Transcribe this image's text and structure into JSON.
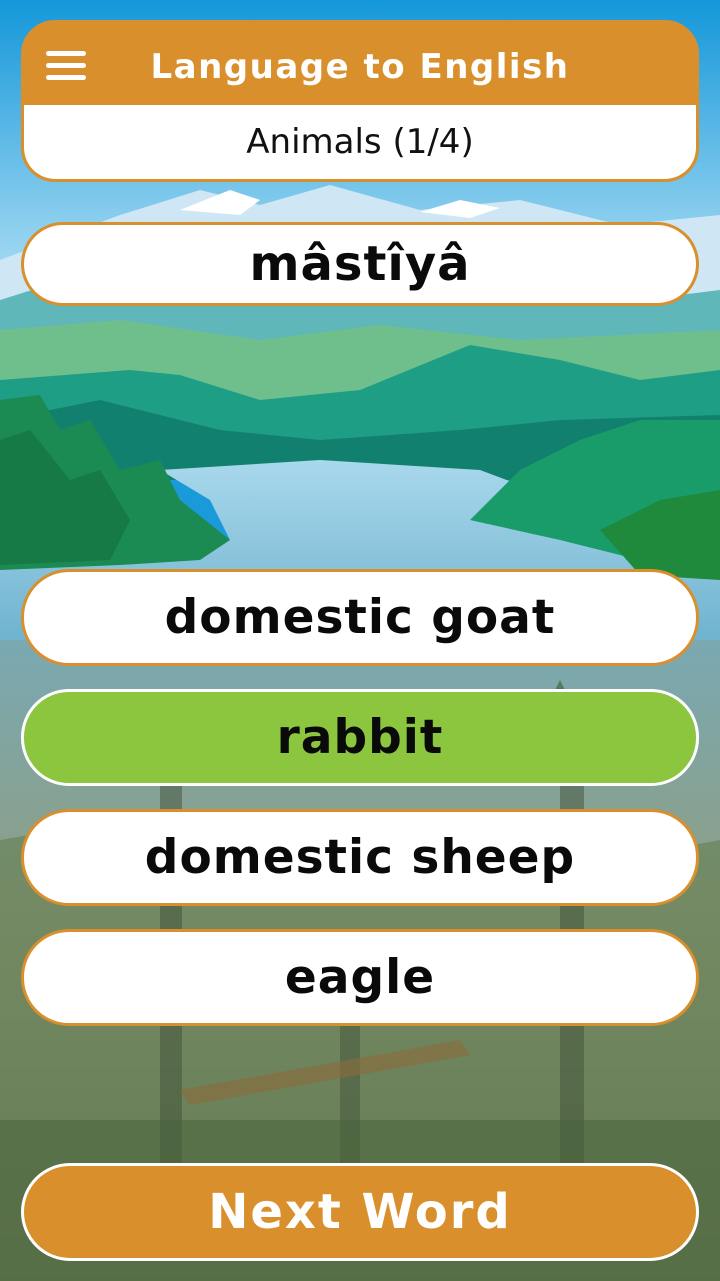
{
  "header": {
    "title": "Language to English",
    "subtitle": "Animals (1/4)"
  },
  "word": "mâstîyâ",
  "choices": [
    "domestic goat",
    "rabbit",
    "domestic sheep",
    "eagle"
  ],
  "selected_choice": "rabbit",
  "next_button": "Next Word",
  "colors": {
    "accent": "#d98f2c",
    "selected": "#8cc63f",
    "card": "#ffffff"
  },
  "icons": {
    "menu": "hamburger-menu-icon"
  }
}
